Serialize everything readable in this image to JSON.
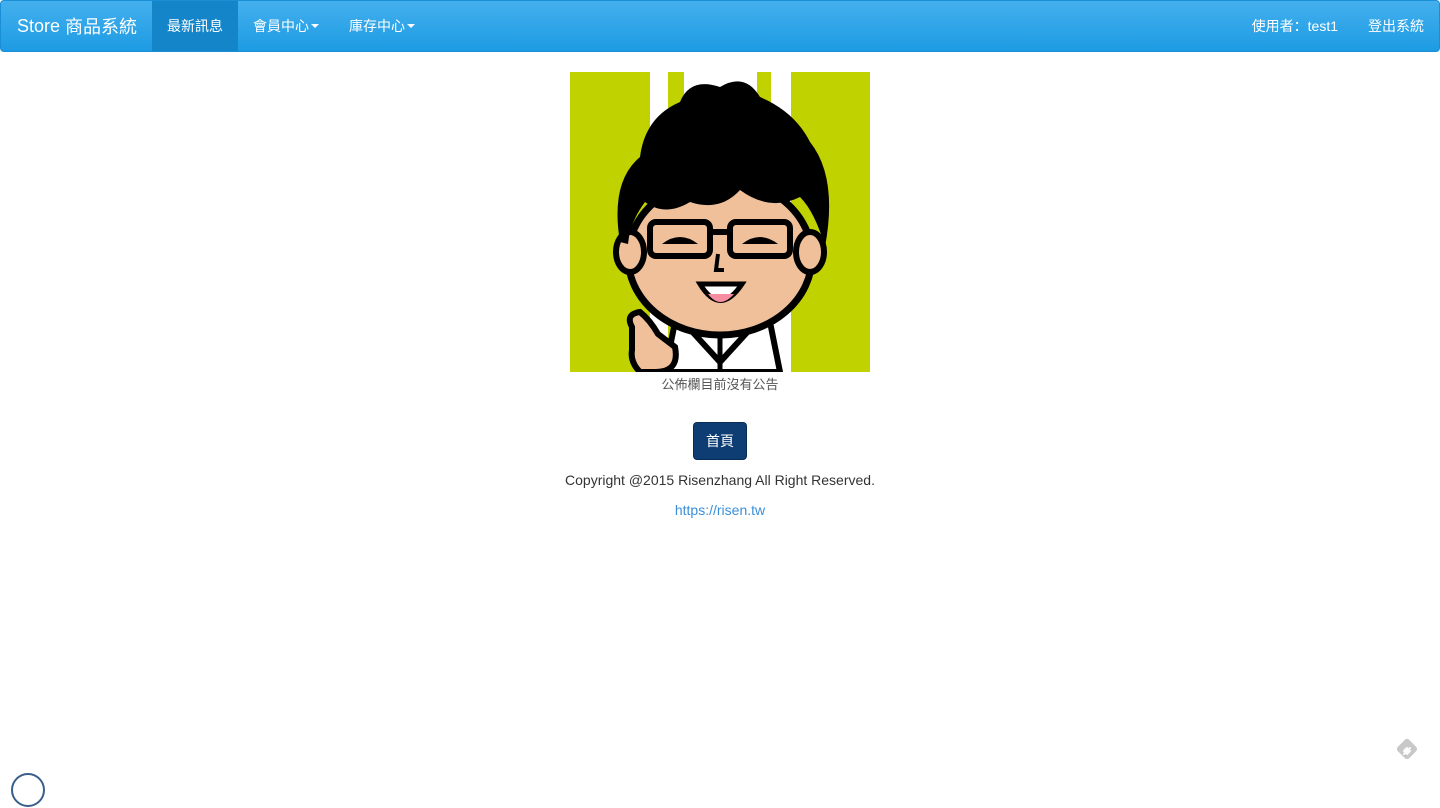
{
  "navbar": {
    "brand_store": "Store",
    "brand_title": "商品系統",
    "items": [
      {
        "label": "最新訊息",
        "active": true,
        "dropdown": false
      },
      {
        "label": "會員中心",
        "active": false,
        "dropdown": true
      },
      {
        "label": "庫存中心",
        "active": false,
        "dropdown": true
      }
    ],
    "user_prefix": "使用者：",
    "user_name": "test1",
    "logout_label": "登出系統"
  },
  "main": {
    "notice_text": "公佈欄目前沒有公告",
    "home_button_label": "首頁"
  },
  "footer": {
    "copyright": "Copyright @2015 Risenzhang All Right Reserved.",
    "link_text": "https://risen.tw"
  },
  "colors": {
    "navbar": "#1d9be3",
    "navbar_active": "#1585c9",
    "home_button": "#0d3d73",
    "link": "#3a8fd8",
    "avatar_stripe": "#c0d300"
  },
  "icons": {
    "corner": "feedly-icon",
    "avatar": "cartoon-avatar-image"
  }
}
